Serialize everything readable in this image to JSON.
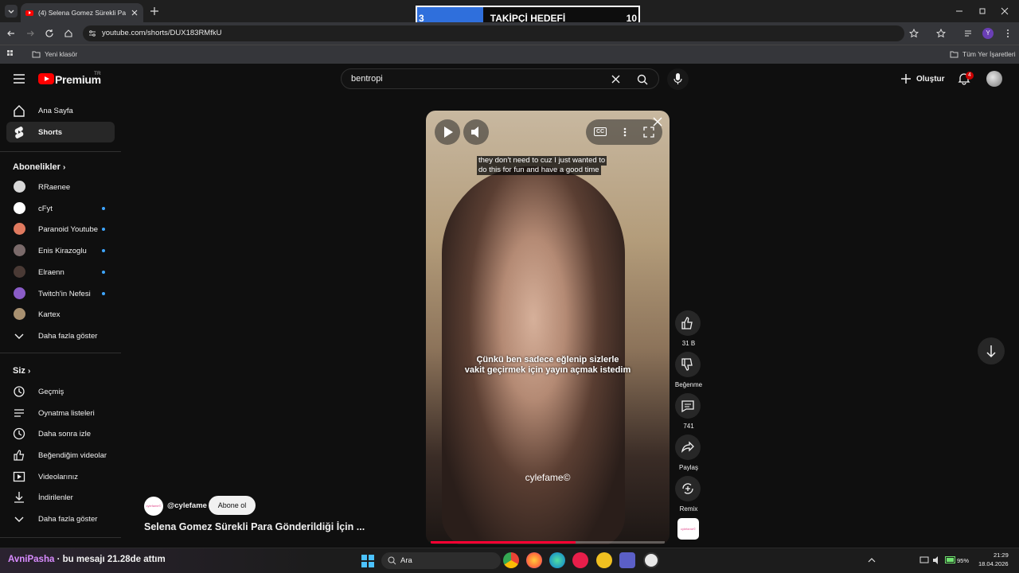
{
  "browser": {
    "tab_title": "(4) Selena Gomez Sürekli Para Gö",
    "url": "youtube.com/shorts/DUX183RMfkU",
    "bookmark_folder": "Yeni klasör",
    "all_bookmarks": "Tüm Yer İşaretleri",
    "profile_initial": "Y"
  },
  "goal_overlay": {
    "current": "3",
    "title": "TAKİPÇİ HEDEFİ",
    "target": "10",
    "progress_fraction": 0.3
  },
  "youtube": {
    "logo": "Premium",
    "region": "TR",
    "search_value": "bentropi",
    "create_label": "Oluştur",
    "notif_count": "4"
  },
  "sidebar": {
    "home": "Ana Sayfa",
    "shorts": "Shorts",
    "subs_header": "Abonelikler",
    "subs": [
      {
        "name": "RRaenee",
        "dot": false,
        "color": "#d8d8d8"
      },
      {
        "name": "cFyt",
        "dot": true,
        "color": "#ffffff"
      },
      {
        "name": "Paranoid Youtube",
        "dot": true,
        "color": "#e07a5f"
      },
      {
        "name": "Enis Kirazoglu",
        "dot": true,
        "color": "#7a6a6a"
      },
      {
        "name": "Elraenn",
        "dot": true,
        "color": "#4a3a35"
      },
      {
        "name": "Twitch'in Nefesi",
        "dot": true,
        "color": "#8a5cc7"
      },
      {
        "name": "Kartex",
        "dot": false,
        "color": "#a89070"
      }
    ],
    "show_more": "Daha fazla göster",
    "you_header": "Siz",
    "history": "Geçmiş",
    "playlists": "Oynatma listeleri",
    "watch_later": "Daha sonra izle",
    "liked": "Beğendiğim videolar",
    "your_videos": "Videolarınız",
    "downloads": "İndirilenler",
    "show_more_2": "Daha fazla göster"
  },
  "short": {
    "caption_line1": "they don't need to cuz I just wanted to",
    "caption_line2": "do this for fun and have a good time",
    "sub_line1": "Çünkü ben sadece eğlenip sizlerle",
    "sub_line2": "vakit geçirmek için yayın açmak istedim",
    "watermark": "cylefame©",
    "cc": "CC",
    "channel": "@cylefame",
    "subscribe": "Abone ol",
    "title": "Selena Gomez Sürekli Para Gönderildiği İçin ...",
    "progress_fraction": 0.62,
    "likes": "31 B",
    "dislike": "Beğenme",
    "comments": "741",
    "share": "Paylaş",
    "remix": "Remix",
    "thumb_text": "cylefame©"
  },
  "taskbar": {
    "chat_user": "AvniPasha",
    "chat_text": "· bu mesajı 21.28de attım",
    "search": "Ara",
    "battery": "95%",
    "time": "21:29",
    "date": "18.04.2026"
  }
}
